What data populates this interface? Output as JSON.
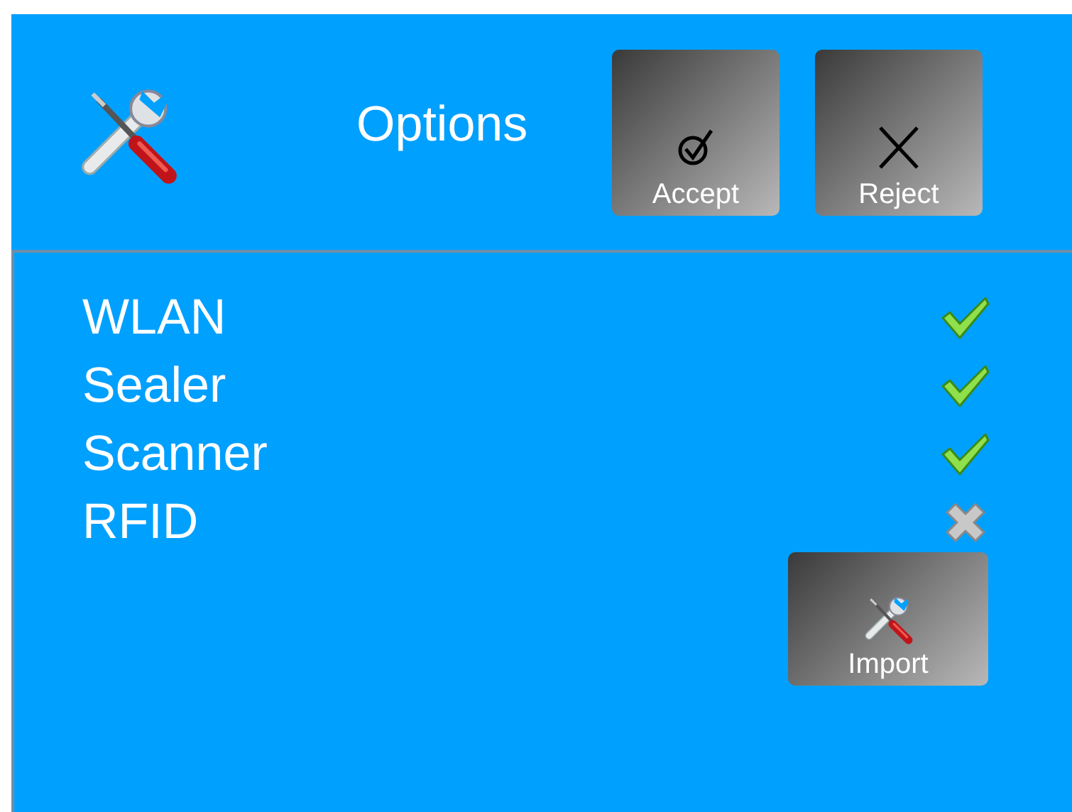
{
  "header": {
    "title": "Options",
    "buttons": [
      {
        "kind": "accept",
        "label": "Accept"
      },
      {
        "kind": "reject",
        "label": "Reject"
      }
    ]
  },
  "options": [
    {
      "label": "WLAN",
      "enabled": true
    },
    {
      "label": "Sealer",
      "enabled": true
    },
    {
      "label": "Scanner",
      "enabled": true
    },
    {
      "label": "RFID",
      "enabled": false
    }
  ],
  "import_button": {
    "label": "Import"
  }
}
